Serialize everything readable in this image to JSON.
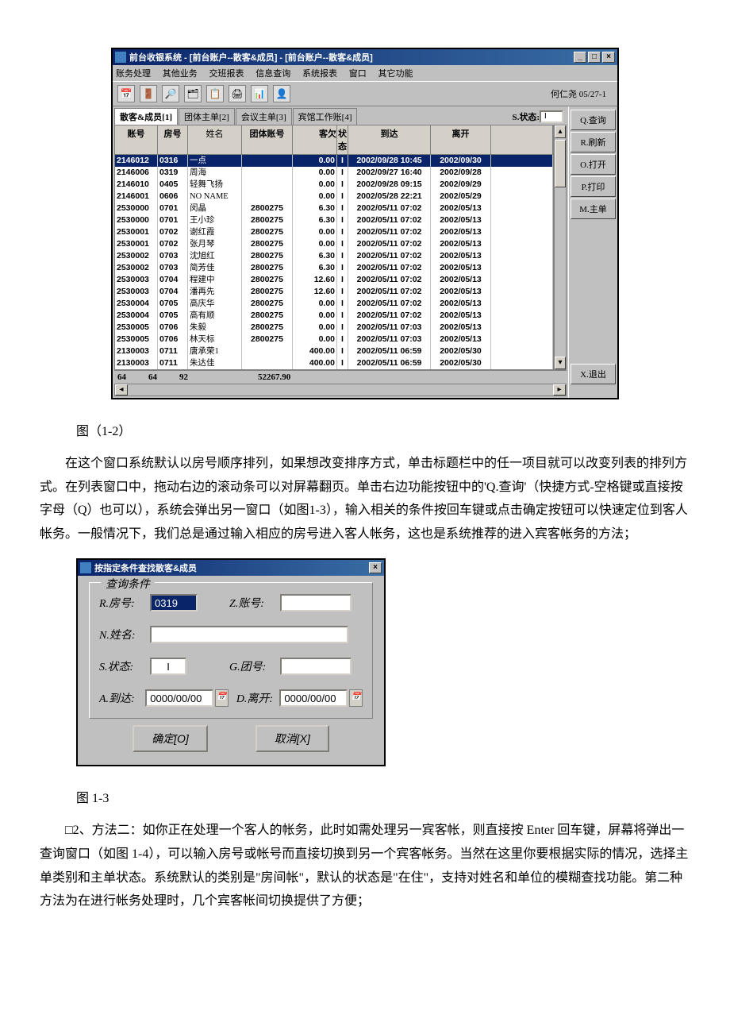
{
  "win1": {
    "title": "前台收银系统 - [前台账户--散客&成员] - [前台账户--散客&成员]",
    "menu": [
      "账务处理",
      "其他业务",
      "交班报表",
      "信息查询",
      "系统报表",
      "窗口",
      "其它功能"
    ],
    "user_label": "何仁尧 05/27-1",
    "tabs": [
      "散客&成员[1]",
      "团体主单[2]",
      "会议主单[3]",
      "宾馆工作账[4]"
    ],
    "status_label": "S.状态:",
    "status_value": "I",
    "grid_headers": {
      "acc": "账号",
      "room": "房号",
      "name": "姓名",
      "group": "团体账号",
      "bal": "客欠",
      "st": "状态",
      "arr": "到达",
      "dep": "离开"
    },
    "rows": [
      {
        "acc": "2146012",
        "room": "0316",
        "name": "一点",
        "group": "",
        "bal": "0.00",
        "st": "I",
        "arr": "2002/09/28 10:45",
        "dep": "2002/09/30",
        "sel": true
      },
      {
        "acc": "2146006",
        "room": "0319",
        "name": "周海",
        "group": "",
        "bal": "0.00",
        "st": "I",
        "arr": "2002/09/27 16:40",
        "dep": "2002/09/28"
      },
      {
        "acc": "2146010",
        "room": "0405",
        "name": "轻舞飞扬",
        "group": "",
        "bal": "0.00",
        "st": "I",
        "arr": "2002/09/28 09:15",
        "dep": "2002/09/29"
      },
      {
        "acc": "2146001",
        "room": "0606",
        "name": "NO NAME",
        "group": "",
        "bal": "0.00",
        "st": "I",
        "arr": "2002/05/28 22:21",
        "dep": "2002/05/29"
      },
      {
        "acc": "2530000",
        "room": "0701",
        "name": "闵晶",
        "group": "2800275",
        "bal": "6.30",
        "st": "I",
        "arr": "2002/05/11 07:02",
        "dep": "2002/05/13"
      },
      {
        "acc": "2530000",
        "room": "0701",
        "name": "王小珍",
        "group": "2800275",
        "bal": "6.30",
        "st": "I",
        "arr": "2002/05/11 07:02",
        "dep": "2002/05/13"
      },
      {
        "acc": "2530001",
        "room": "0702",
        "name": "谢红霞",
        "group": "2800275",
        "bal": "0.00",
        "st": "I",
        "arr": "2002/05/11 07:02",
        "dep": "2002/05/13"
      },
      {
        "acc": "2530001",
        "room": "0702",
        "name": "张月琴",
        "group": "2800275",
        "bal": "0.00",
        "st": "I",
        "arr": "2002/05/11 07:02",
        "dep": "2002/05/13"
      },
      {
        "acc": "2530002",
        "room": "0703",
        "name": "沈旭红",
        "group": "2800275",
        "bal": "6.30",
        "st": "I",
        "arr": "2002/05/11 07:02",
        "dep": "2002/05/13"
      },
      {
        "acc": "2530002",
        "room": "0703",
        "name": "简芳佳",
        "group": "2800275",
        "bal": "6.30",
        "st": "I",
        "arr": "2002/05/11 07:02",
        "dep": "2002/05/13"
      },
      {
        "acc": "2530003",
        "room": "0704",
        "name": "程建中",
        "group": "2800275",
        "bal": "12.60",
        "st": "I",
        "arr": "2002/05/11 07:02",
        "dep": "2002/05/13"
      },
      {
        "acc": "2530003",
        "room": "0704",
        "name": "潘再先",
        "group": "2800275",
        "bal": "12.60",
        "st": "I",
        "arr": "2002/05/11 07:02",
        "dep": "2002/05/13"
      },
      {
        "acc": "2530004",
        "room": "0705",
        "name": "高庆华",
        "group": "2800275",
        "bal": "0.00",
        "st": "I",
        "arr": "2002/05/11 07:02",
        "dep": "2002/05/13"
      },
      {
        "acc": "2530004",
        "room": "0705",
        "name": "高有顺",
        "group": "2800275",
        "bal": "0.00",
        "st": "I",
        "arr": "2002/05/11 07:02",
        "dep": "2002/05/13"
      },
      {
        "acc": "2530005",
        "room": "0706",
        "name": "朱毅",
        "group": "2800275",
        "bal": "0.00",
        "st": "I",
        "arr": "2002/05/11 07:03",
        "dep": "2002/05/13"
      },
      {
        "acc": "2530005",
        "room": "0706",
        "name": "林天标",
        "group": "2800275",
        "bal": "0.00",
        "st": "I",
        "arr": "2002/05/11 07:03",
        "dep": "2002/05/13"
      },
      {
        "acc": "2130003",
        "room": "0711",
        "name": "唐承荣1",
        "group": "",
        "bal": "400.00",
        "st": "I",
        "arr": "2002/05/11 06:59",
        "dep": "2002/05/30"
      },
      {
        "acc": "2130003",
        "room": "0711",
        "name": "朱达佳",
        "group": "",
        "bal": "400.00",
        "st": "I",
        "arr": "2002/05/11 06:59",
        "dep": "2002/05/30"
      }
    ],
    "footer": {
      "c1": "64",
      "c2": "64",
      "c3": "92",
      "total": "52267.90"
    },
    "side_buttons": [
      "Q.查询",
      "R.刷新",
      "O.打开",
      "P.打印",
      "M.主单"
    ],
    "exit_button": "X.退出"
  },
  "caption1": "图（1-2）",
  "para1": "在这个窗口系统默认以房号顺序排列，如果想改变排序方式，单击标题栏中的任一项目就可以改变列表的排列方式。在列表窗口中，拖动右边的滚动条可以对屏幕翻页。单击右边功能按钮中的'Q.查询'（快捷方式-空格键或直接按字母（Q）也可以），系统会弹出另一窗口（如图1-3），输入相关的条件按回车键或点击确定按钮可以快速定位到客人帐务。一般情况下，我们总是通过输入相应的房号进入客人帐务，这也是系统推荐的进入宾客帐务的方法；",
  "dlg": {
    "title": "按指定条件查找散客&成员",
    "group_title": "查询条件",
    "room_lbl": "R.房号:",
    "room_val": "0319",
    "acc_lbl": "Z.账号:",
    "acc_val": "",
    "name_lbl": "N.姓名:",
    "name_val": "",
    "status_lbl": "S.状态:",
    "status_val": "I",
    "group_lbl": "G.团号:",
    "group_val": "",
    "arr_lbl": "A.到达:",
    "arr_val": "0000/00/00",
    "dep_lbl": "D.离开:",
    "dep_val": "0000/00/00",
    "ok": "确定[O]",
    "cancel": "取消[X]"
  },
  "caption2": "图 1-3",
  "para2": "□2、方法二：如你正在处理一个客人的帐务，此时如需处理另一宾客帐，则直接按 Enter 回车键，屏幕将弹出一查询窗口（如图 1-4），可以输入房号或帐号而直接切换到另一个宾客帐务。当然在这里你要根据实际的情况，选择主单类别和主单状态。系统默认的类别是\"房间帐\"，默认的状态是\"在住\"，支持对姓名和单位的模糊查找功能。第二种方法为在进行帐务处理时，几个宾客帐间切换提供了方便；"
}
